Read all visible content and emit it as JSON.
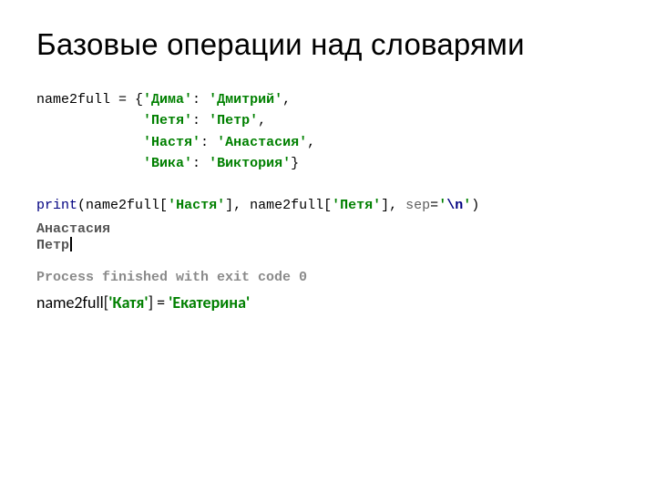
{
  "title": "Базовые операции над словарями",
  "code": {
    "var": "name2full",
    "pairs": [
      {
        "k": "'Дима'",
        "v": "'Дмитрий'"
      },
      {
        "k": "'Петя'",
        "v": "'Петр'"
      },
      {
        "k": "'Настя'",
        "v": "'Анастасия'"
      },
      {
        "k": "'Вика'",
        "v": "'Виктория'"
      }
    ],
    "print_kw": "print",
    "print_arg1_key": "'Настя'",
    "print_arg2_key": "'Петя'",
    "sep_name": "sep",
    "sep_val_open": "'",
    "sep_esc": "\\n",
    "sep_val_close": "'"
  },
  "output": {
    "line1": "Анастасия",
    "line2": "Петр"
  },
  "process": "Process finished with exit code 0",
  "assign": {
    "lhs": "name2full[",
    "key": "'Катя'",
    "mid": "] = ",
    "val": "'Екатерина'"
  }
}
